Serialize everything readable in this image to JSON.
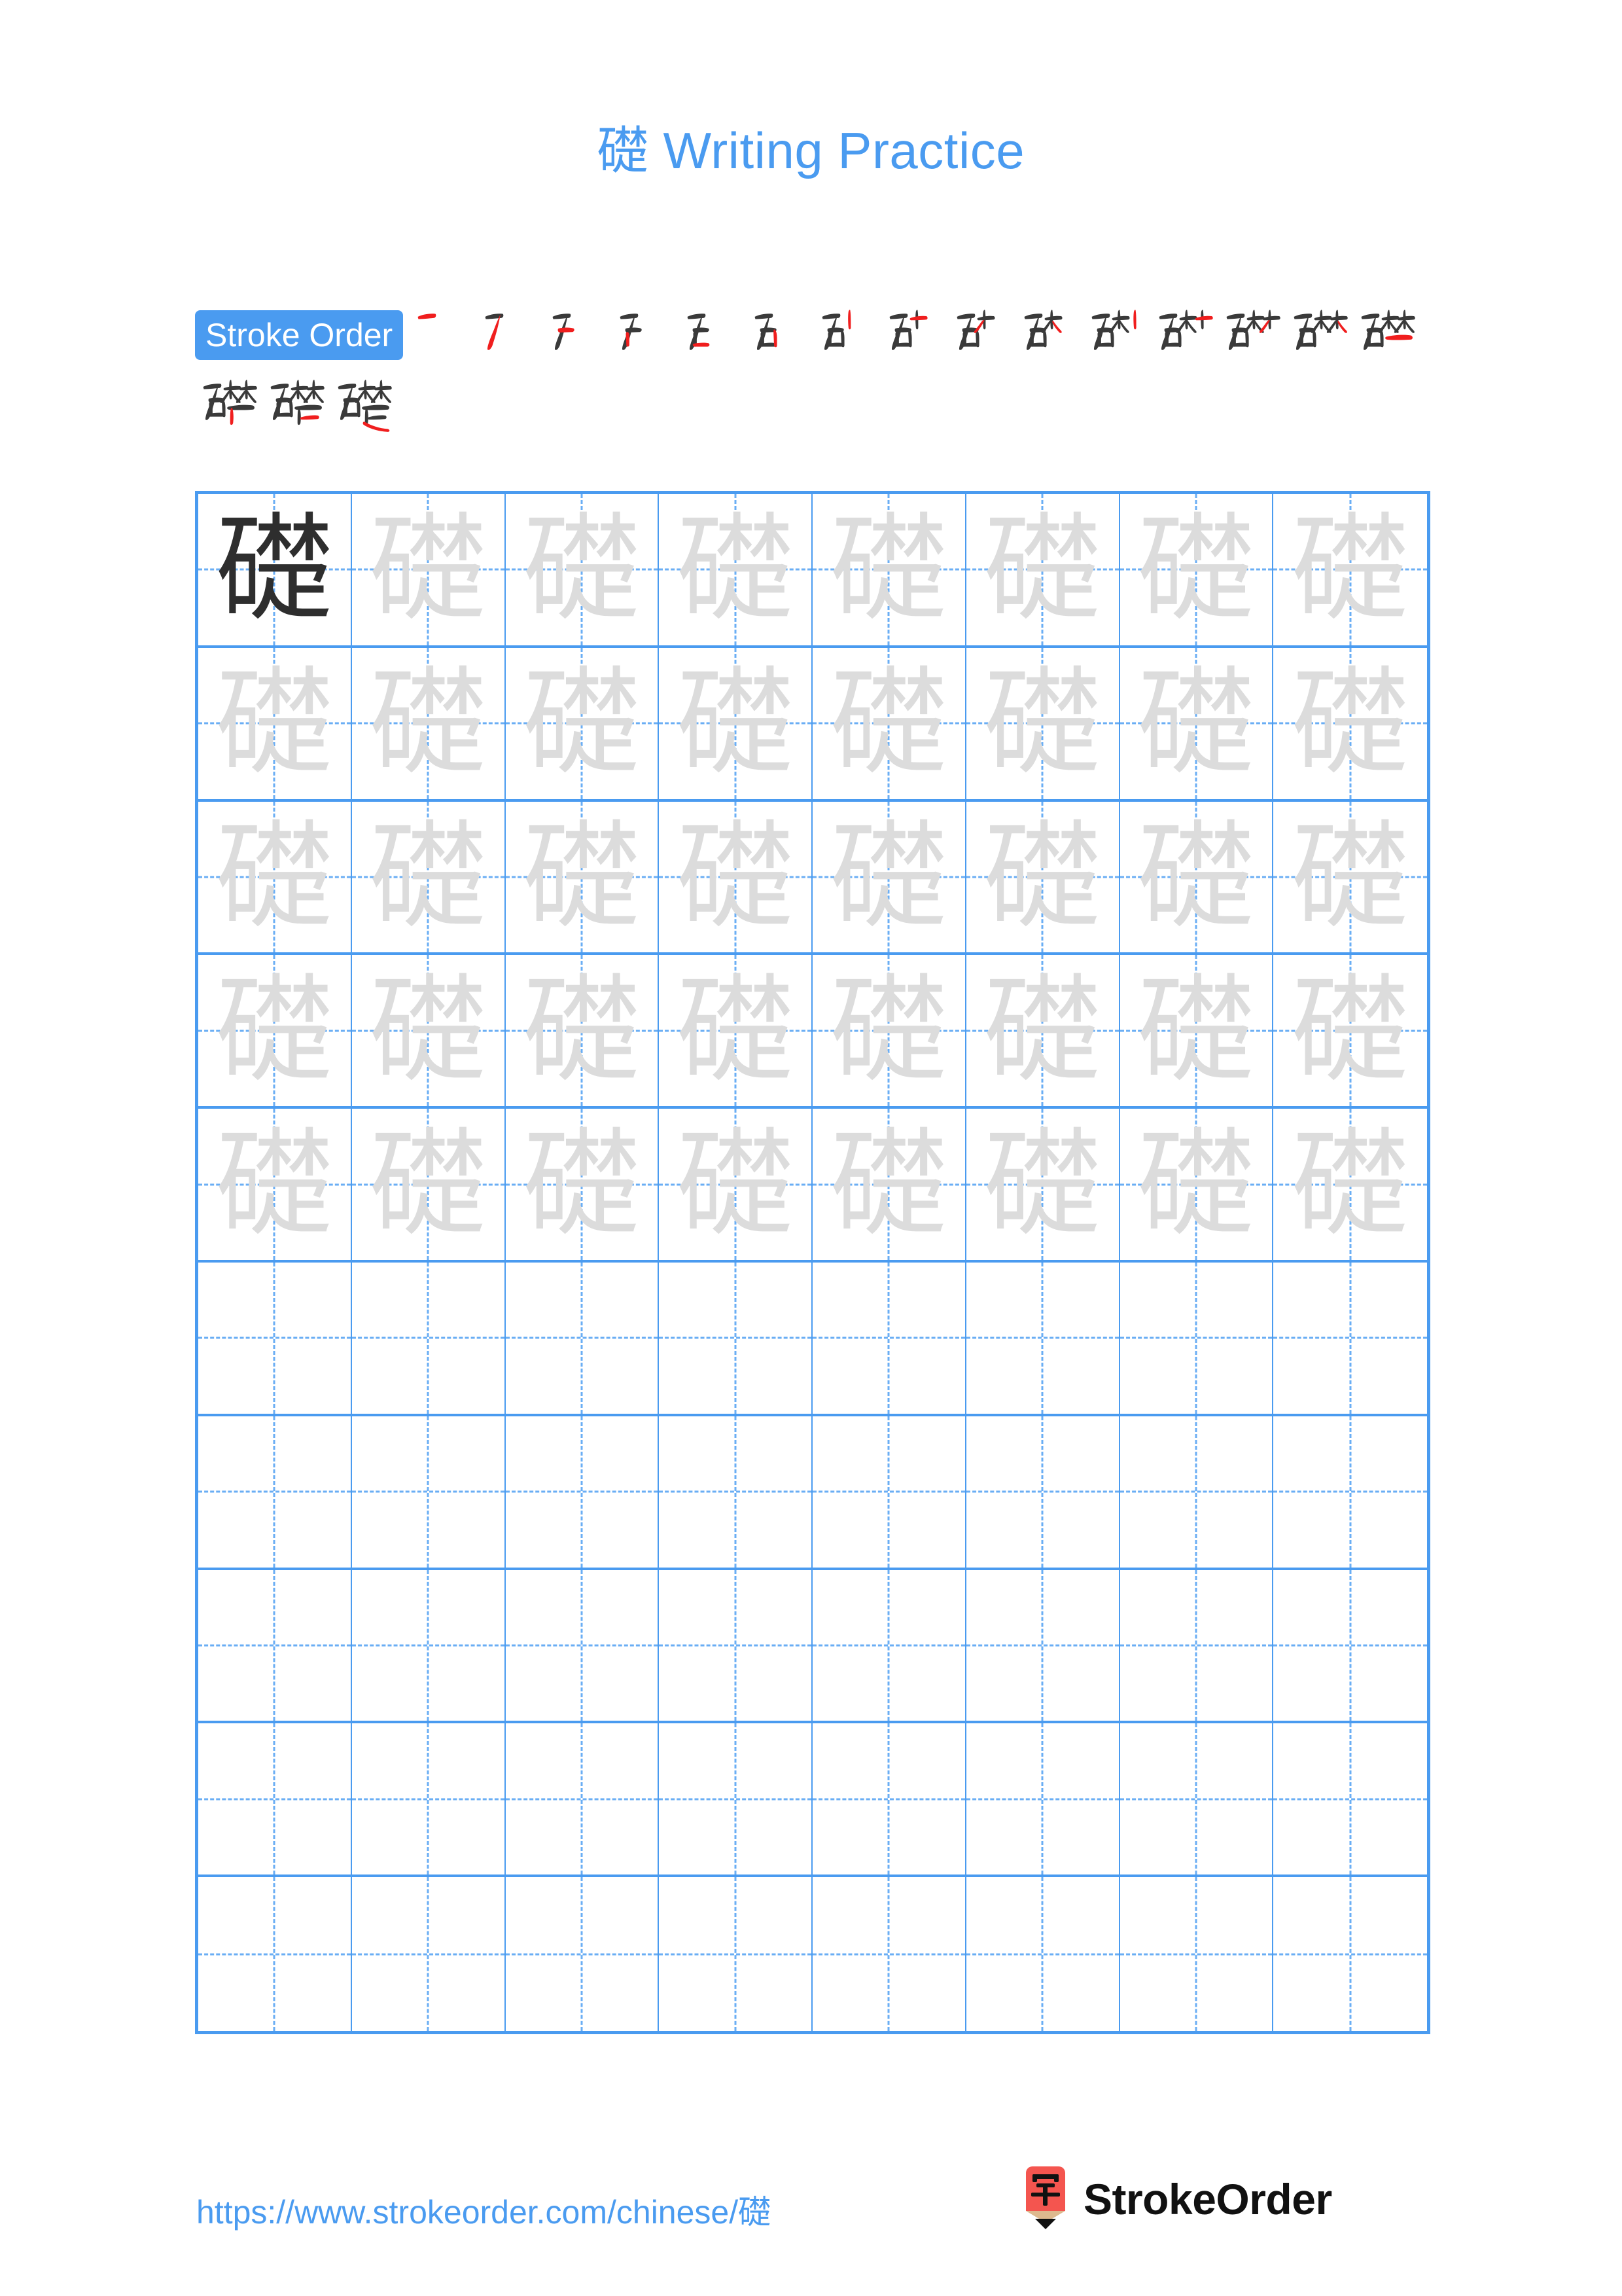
{
  "page": {
    "character": "礎",
    "background_color": "#ffffff",
    "accent_color": "#4a9bf0"
  },
  "header": {
    "title_character": "礎",
    "title_text": " Writing Practice",
    "title_full": "礎 Writing Practice",
    "title_color": "#4a9bf0"
  },
  "stroke_order": {
    "badge_label": "Stroke Order",
    "badge_bg": "#4a9bf0",
    "badge_text_color": "#ffffff",
    "total_strokes": 18,
    "new_stroke_color": "#f01e1e",
    "previous_stroke_color": "#3a3a3a",
    "steps": [
      {
        "index": 1,
        "partial": "一"
      },
      {
        "index": 2,
        "partial": "丆"
      },
      {
        "index": 3,
        "partial": "ナ"
      },
      {
        "index": 4,
        "partial": "石"
      },
      {
        "index": 5,
        "partial": "石"
      },
      {
        "index": 6,
        "partial": "石丿"
      },
      {
        "index": 7,
        "partial": "石十"
      },
      {
        "index": 8,
        "partial": "石木"
      },
      {
        "index": 9,
        "partial": "石木"
      },
      {
        "index": 10,
        "partial": "石杧"
      },
      {
        "index": 11,
        "partial": "石村"
      },
      {
        "index": 12,
        "partial": "石村"
      },
      {
        "index": 13,
        "partial": "石林"
      },
      {
        "index": 14,
        "partial": "礎"
      },
      {
        "index": 15,
        "partial": "礎"
      },
      {
        "index": 16,
        "partial": "礎"
      },
      {
        "index": 17,
        "partial": "礎"
      },
      {
        "index": 18,
        "partial": "礎"
      }
    ]
  },
  "practice_grid": {
    "columns": 8,
    "rows": 10,
    "grid_line_color": "#4a9bf0",
    "guide_line_color": "#6aaef4",
    "model_char_color": "#2e2e2e",
    "trace_char_color": "#dcdcdc",
    "cells": [
      [
        "model",
        "trace",
        "trace",
        "trace",
        "trace",
        "trace",
        "trace",
        "trace"
      ],
      [
        "trace",
        "trace",
        "trace",
        "trace",
        "trace",
        "trace",
        "trace",
        "trace"
      ],
      [
        "trace",
        "trace",
        "trace",
        "trace",
        "trace",
        "trace",
        "trace",
        "trace"
      ],
      [
        "trace",
        "trace",
        "trace",
        "trace",
        "trace",
        "trace",
        "trace",
        "trace"
      ],
      [
        "trace",
        "trace",
        "trace",
        "trace",
        "trace",
        "trace",
        "trace",
        "trace"
      ],
      [
        "empty",
        "empty",
        "empty",
        "empty",
        "empty",
        "empty",
        "empty",
        "empty"
      ],
      [
        "empty",
        "empty",
        "empty",
        "empty",
        "empty",
        "empty",
        "empty",
        "empty"
      ],
      [
        "empty",
        "empty",
        "empty",
        "empty",
        "empty",
        "empty",
        "empty",
        "empty"
      ],
      [
        "empty",
        "empty",
        "empty",
        "empty",
        "empty",
        "empty",
        "empty",
        "empty"
      ],
      [
        "empty",
        "empty",
        "empty",
        "empty",
        "empty",
        "empty",
        "empty",
        "empty"
      ]
    ]
  },
  "footer": {
    "url": "https://www.strokeorder.com/chinese/礎",
    "url_color": "#4a9bf0",
    "brand_name": "StrokeOrder",
    "logo_glyph": "字",
    "logo_body_color": "#f4554f",
    "logo_wood_color": "#ddb98e",
    "logo_tip_color": "#111111"
  }
}
